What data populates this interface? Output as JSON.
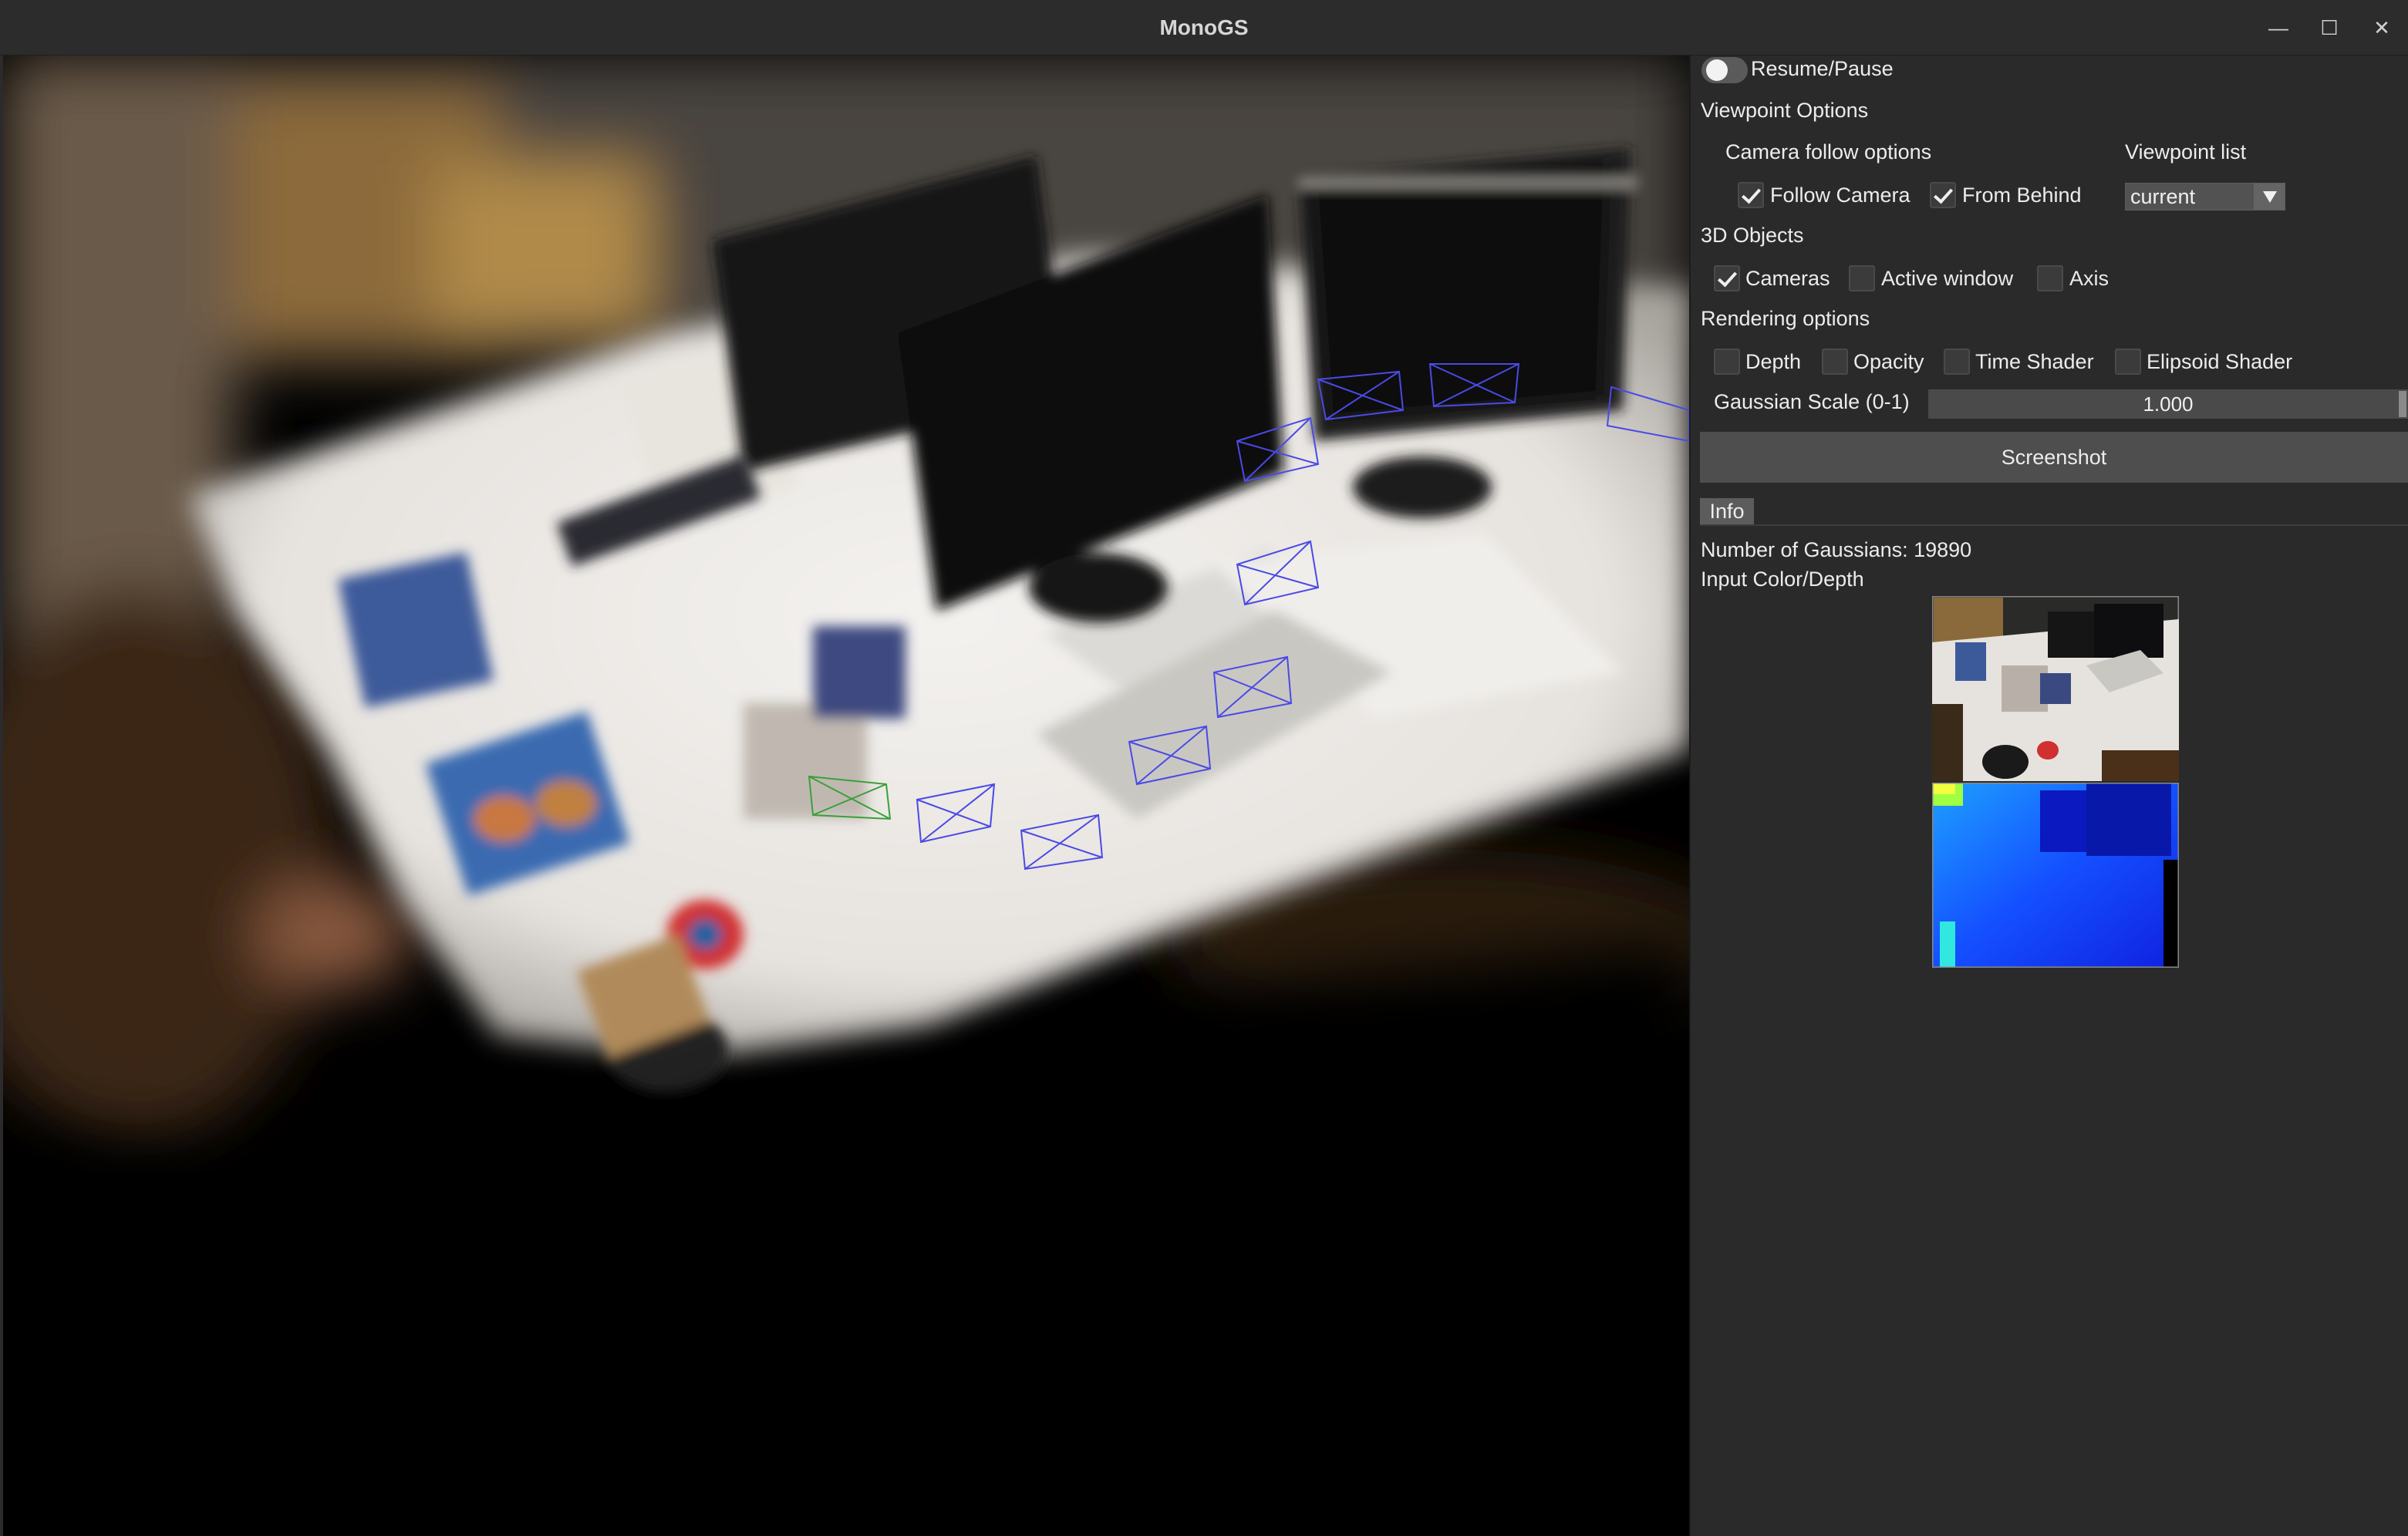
{
  "window": {
    "title": "MonoGS",
    "minimize_glyph": "—",
    "maximize_glyph": "☐",
    "close_glyph": "✕"
  },
  "panel": {
    "resume_pause_label": "Resume/Pause",
    "viewpoint_options_heading": "Viewpoint Options",
    "camera_follow_heading": "Camera follow options",
    "viewpoint_list_heading": "Viewpoint list",
    "follow_camera": {
      "label": "Follow Camera",
      "checked": true
    },
    "from_behind": {
      "label": "From Behind",
      "checked": true
    },
    "viewpoint_select_value": "current",
    "objects_heading": "3D Objects",
    "cameras": {
      "label": "Cameras",
      "checked": true
    },
    "active_window": {
      "label": "Active window",
      "checked": false
    },
    "axis": {
      "label": "Axis",
      "checked": false
    },
    "rendering_heading": "Rendering options",
    "depth": {
      "label": "Depth",
      "checked": false
    },
    "opacity": {
      "label": "Opacity",
      "checked": false
    },
    "time_shader": {
      "label": "Time Shader",
      "checked": false
    },
    "elipsoid_shader": {
      "label": "Elipsoid Shader",
      "checked": false
    },
    "gaussian_scale_label": "Gaussian Scale (0-1)",
    "gaussian_scale_value": "1.000",
    "screenshot_label": "Screenshot",
    "info_tab_label": "Info",
    "num_gaussians_text": "Number of Gaussians: 19890",
    "input_color_depth_label": "Input Color/Depth"
  },
  "colors": {
    "panel_bg": "#2a2a2a",
    "viewport_bg": "#000000",
    "camera_frustum": "#4a4ae6",
    "active_frustum": "#3aa03a",
    "depth_map": "#1a3cff"
  },
  "icons": [
    "minimize-icon",
    "maximize-icon",
    "close-icon",
    "chevron-down-icon"
  ]
}
